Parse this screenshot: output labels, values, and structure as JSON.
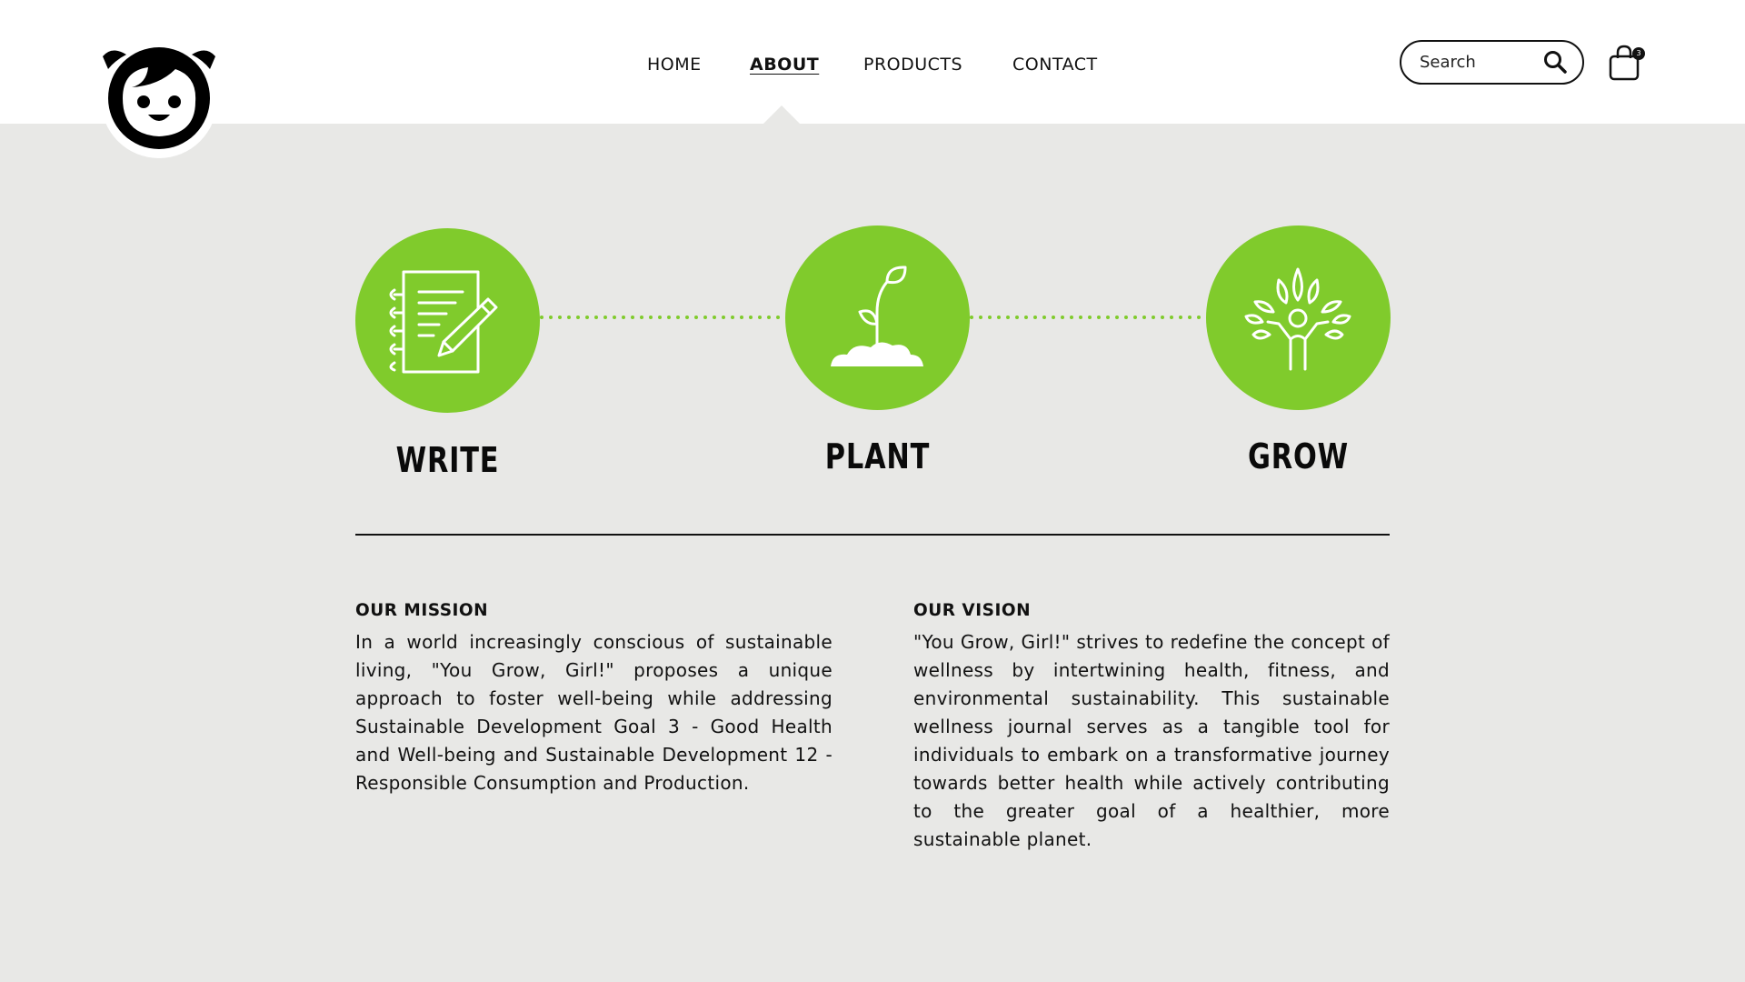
{
  "header": {
    "nav": [
      {
        "label": "HOME",
        "active": false
      },
      {
        "label": "ABOUT",
        "active": true
      },
      {
        "label": "PRODUCTS",
        "active": false
      },
      {
        "label": "CONTACT",
        "active": false
      }
    ],
    "search": {
      "placeholder": "Search"
    },
    "cart": {
      "count": "3"
    }
  },
  "steps": [
    {
      "label": "WRITE",
      "icon": "notebook-pencil-icon"
    },
    {
      "label": "PLANT",
      "icon": "sprout-icon"
    },
    {
      "label": "GROW",
      "icon": "tree-person-icon"
    }
  ],
  "mission": {
    "title": "OUR MISSION",
    "text": "In a world increasingly conscious of sustainable living, \"You Grow, Girl!\" proposes a unique approach to foster well-being while addressing Sustainable Development Goal 3 - Good Health and Well-being and Sustainable Development 12 - Responsible Consumption and Production."
  },
  "vision": {
    "title": "OUR VISION",
    "text": "\"You Grow, Girl!\" strives to redefine the concept of wellness by intertwining health, fitness, and environmental sustainability. This sustainable wellness journal serves as a tangible tool for individuals to embark on a transformative journey towards better health while actively contributing to the greater goal of a healthier, more sustainable planet."
  },
  "colors": {
    "accent": "#80cb2c",
    "background": "#e8e8e6",
    "header": "#ffffff",
    "text": "#111111"
  }
}
